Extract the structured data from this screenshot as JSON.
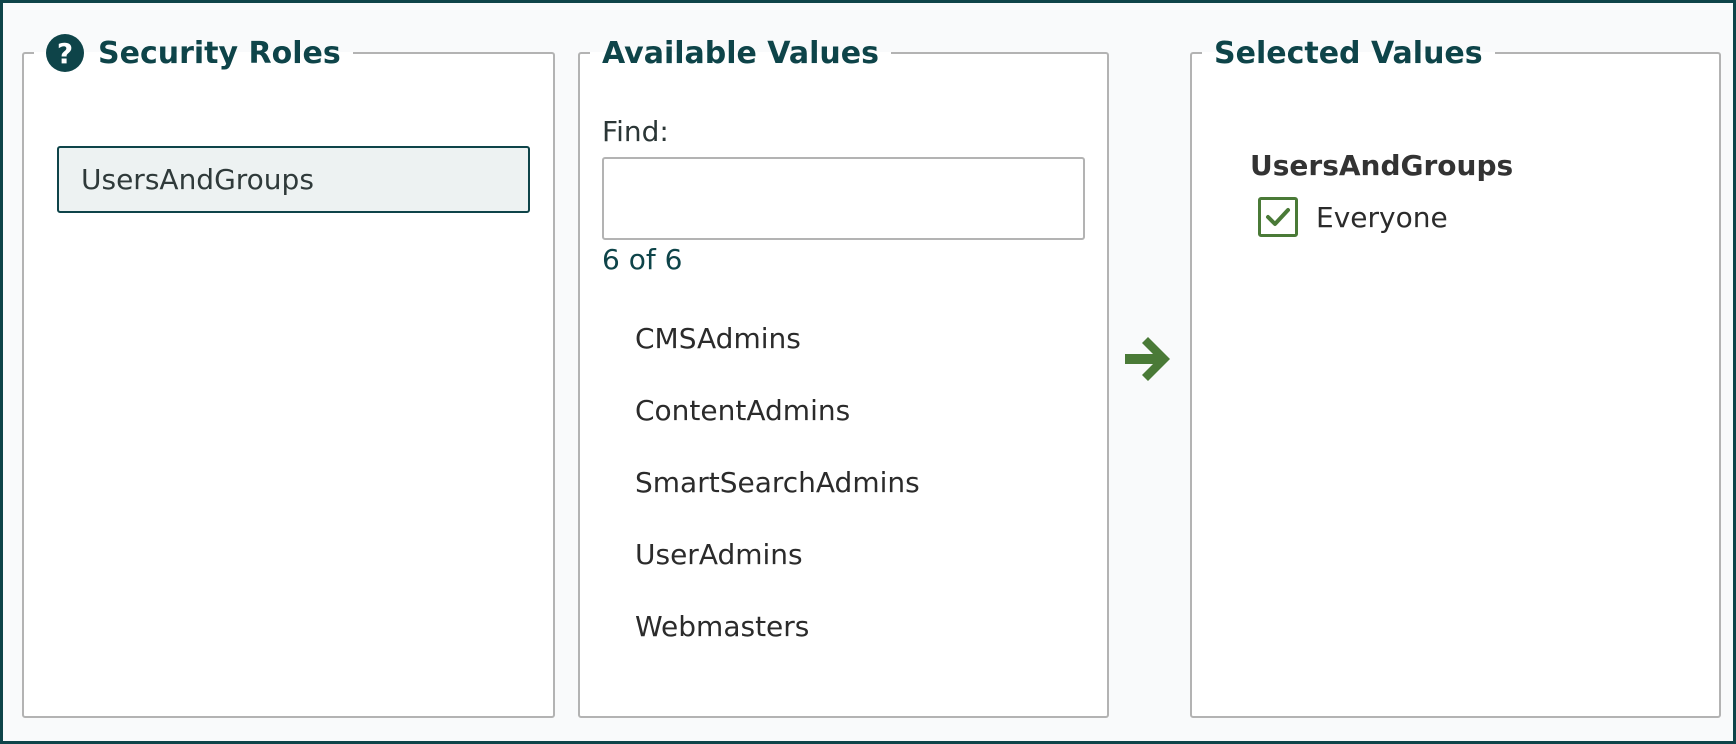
{
  "roles_panel": {
    "title": "Security Roles",
    "items": [
      {
        "label": "UsersAndGroups",
        "selected": true
      }
    ]
  },
  "available_panel": {
    "title": "Available Values",
    "find_label": "Find:",
    "find_value": "",
    "find_placeholder": "",
    "count": "6 of 6",
    "items": [
      "CMSAdmins",
      "ContentAdmins",
      "SmartSearchAdmins",
      "UserAdmins",
      "Webmasters"
    ]
  },
  "selected_panel": {
    "title": "Selected Values",
    "group": "UsersAndGroups",
    "items": [
      {
        "label": "Everyone",
        "checked": true
      }
    ]
  },
  "colors": {
    "accent": "#0e4449",
    "success": "#4a7a37"
  }
}
